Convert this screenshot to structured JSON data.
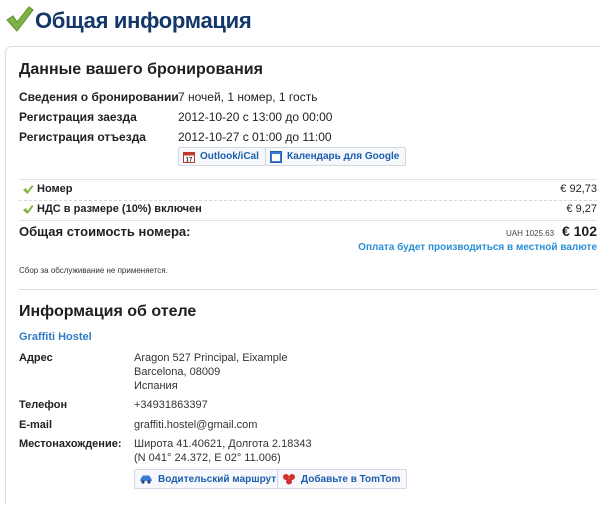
{
  "header": {
    "title": "Общая информация",
    "icon": "checkmark-icon"
  },
  "booking": {
    "title": "Данные вашего бронирования",
    "rows": [
      {
        "label": "Сведения о бронировании",
        "value": "7 ночей, 1 номер, 1 гость"
      },
      {
        "label": "Регистрация заезда",
        "value": "2012-10-20 с 13:00 до 00:00"
      },
      {
        "label": "Регистрация отъезда",
        "value": "2012-10-27 с 01:00 до 11:00"
      }
    ],
    "buttons": {
      "outlook": "Outlook/iCal",
      "google": "Календарь для Google"
    }
  },
  "pricing": {
    "lines": [
      {
        "label": "Номер",
        "amount": "€ 92,73"
      },
      {
        "label": "НДС в размере (10%) включен",
        "amount": "€ 9,27"
      }
    ],
    "total_label": "Общая стоимость номера:",
    "total_uah": "UAH 1025.63",
    "total_amount": "€ 102",
    "pay_note": "Оплата будет производиться в местной валюте",
    "service_note": "Сбор за обслуживание не применяется."
  },
  "hotel": {
    "title": "Информация об отеле",
    "name": "Graffiti Hostel",
    "address_label": "Адрес",
    "address_lines": [
      "Aragon 527 Principal, Eixample",
      "Barcelona, 08009",
      "Испания"
    ],
    "phone_label": "Телефон",
    "phone": "+34931863397",
    "email_label": "E-mail",
    "email": "graffiti.hostel@gmail.com",
    "location_label": "Местонахождение:",
    "location_lines": [
      "Широта 41.40621, Долгота 2.18343",
      "(N 041° 24.372, E 02° 11.006)"
    ],
    "buttons": {
      "route": "Водительский маршрут",
      "tomtom": "Добавьте в TomTom"
    }
  },
  "colors": {
    "title": "#14376b",
    "link": "#2f7cc7",
    "pay_note": "#2a8fd6",
    "check": "#7cb342"
  }
}
